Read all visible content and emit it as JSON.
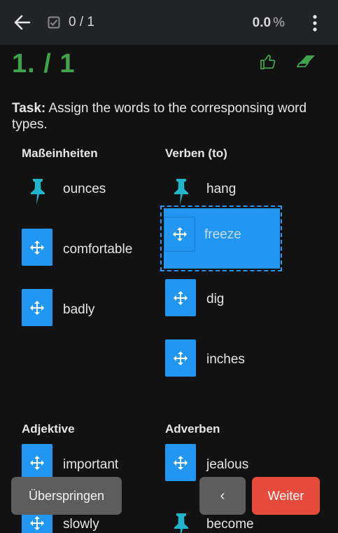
{
  "header": {
    "progress_count": "0 / 1",
    "percent_value": "0.0",
    "percent_symbol": "%"
  },
  "question": {
    "number": "1. / 1",
    "task_label": "Task:",
    "task_text": " Assign the words to the corresponsing word types."
  },
  "categories": [
    {
      "title": "Maßeinheiten",
      "words": [
        "ounces",
        "comfortable",
        "badly"
      ]
    },
    {
      "title": "Verben (to)",
      "words": [
        "hang",
        "dig",
        "inches"
      ]
    },
    {
      "title": "Adjektive",
      "words": [
        "important",
        "slowly"
      ]
    },
    {
      "title": "Adverben",
      "words": [
        "jealous",
        "become"
      ]
    }
  ],
  "dragging": {
    "label": "freeze"
  },
  "buttons": {
    "skip": "Überspringen",
    "prev": "‹",
    "next": "Weiter"
  },
  "colors": {
    "accent_blue": "#2196f3",
    "pin_teal": "#1fb6cc",
    "success_green": "#3fa34d",
    "next_red": "#e64a3b",
    "topbar_bg": "#222326"
  }
}
